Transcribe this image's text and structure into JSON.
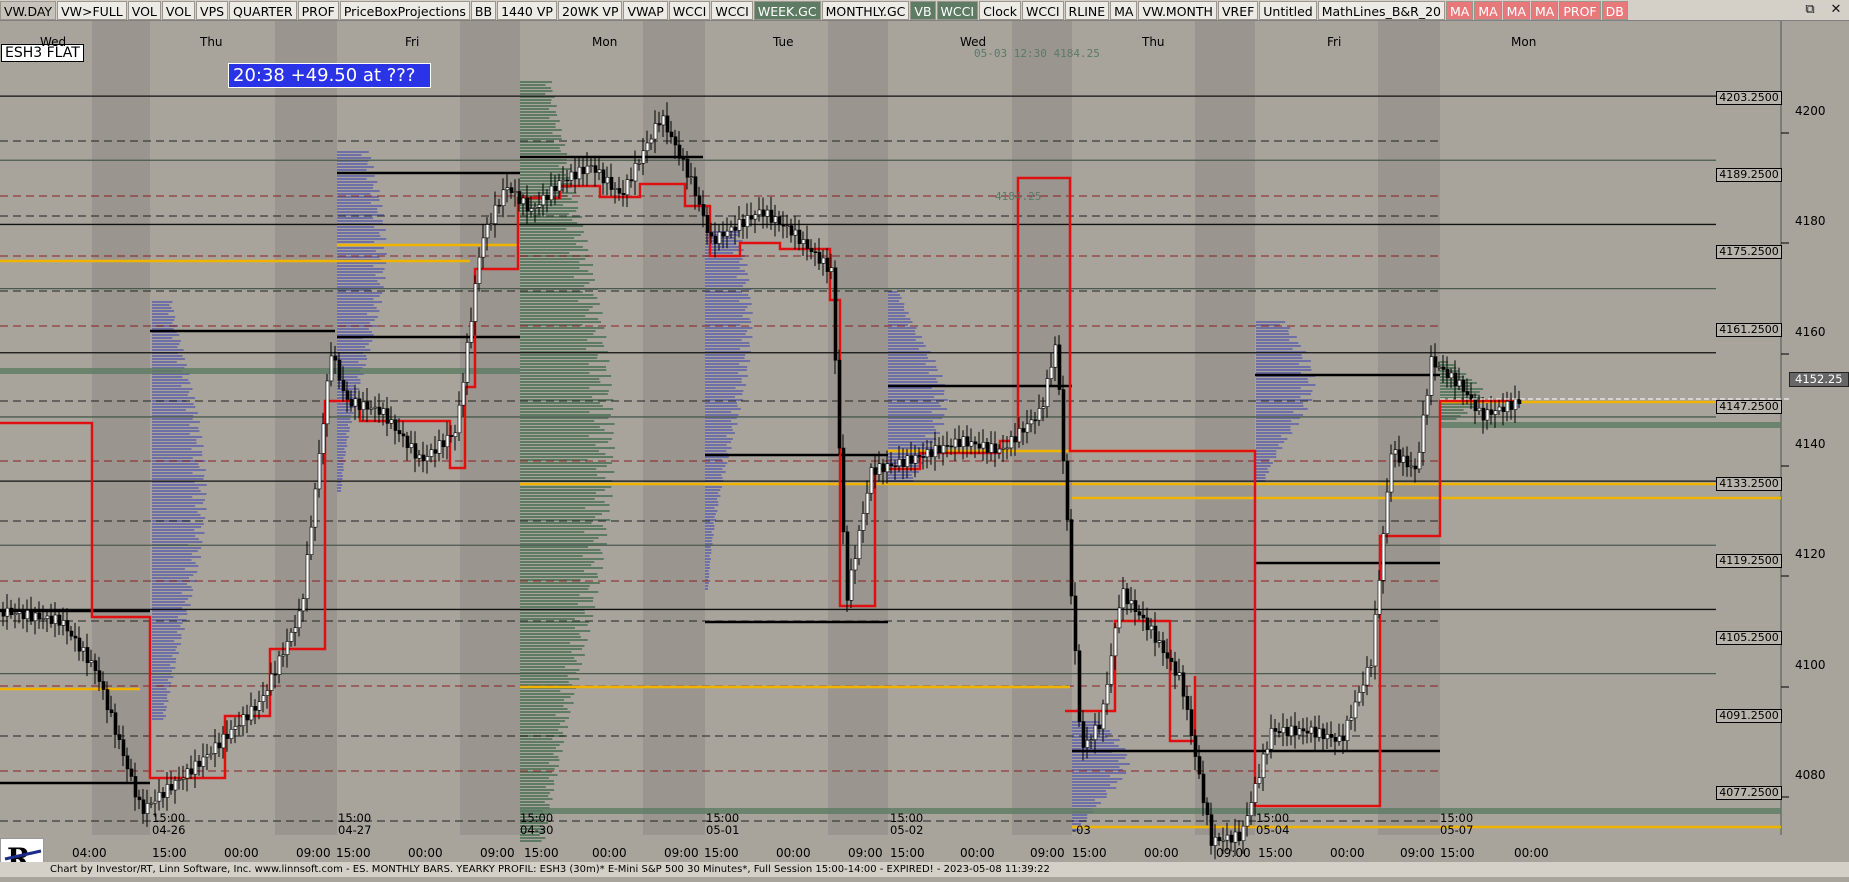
{
  "toolbar": {
    "buttons": [
      {
        "label": "VW.DAY",
        "style": "sel"
      },
      {
        "label": "VW>FULL",
        "style": ""
      },
      {
        "label": "VOL",
        "style": ""
      },
      {
        "label": "VOL",
        "style": ""
      },
      {
        "label": "VPS",
        "style": ""
      },
      {
        "label": "QUARTER",
        "style": ""
      },
      {
        "label": "PROF",
        "style": ""
      },
      {
        "label": "PriceBoxProjections",
        "style": ""
      },
      {
        "label": "BB",
        "style": ""
      },
      {
        "label": "1440 VP",
        "style": ""
      },
      {
        "label": "20WK VP",
        "style": ""
      },
      {
        "label": "VWAP",
        "style": ""
      },
      {
        "label": "WCCI",
        "style": ""
      },
      {
        "label": "WCCI",
        "style": ""
      },
      {
        "label": "WEEK.GC",
        "style": "green"
      },
      {
        "label": "MONTHLY.GC",
        "style": ""
      },
      {
        "label": "VB",
        "style": "green"
      },
      {
        "label": "WCCI",
        "style": "green"
      },
      {
        "label": "Clock",
        "style": ""
      },
      {
        "label": "WCCI",
        "style": ""
      },
      {
        "label": "RLINE",
        "style": ""
      },
      {
        "label": "MA",
        "style": ""
      },
      {
        "label": "VW.MONTH",
        "style": ""
      },
      {
        "label": "VREF",
        "style": ""
      },
      {
        "label": "Untitled",
        "style": ""
      },
      {
        "label": "MathLines_B&R_20",
        "style": ""
      },
      {
        "label": "MA",
        "style": "red"
      },
      {
        "label": "MA",
        "style": "red"
      },
      {
        "label": "MA",
        "style": "red"
      },
      {
        "label": "MA",
        "style": "red"
      },
      {
        "label": "PROF",
        "style": "red"
      },
      {
        "label": "DB",
        "style": "red"
      }
    ],
    "window_controls": [
      "⧉",
      "✕"
    ]
  },
  "chart": {
    "symbol_label": "ESH3 FLAT",
    "info_box": "20:38  +49.50 at ???",
    "cursor_readout": "05-03  12:30  4184.25",
    "marker_label": "4184.25",
    "current_price": "4152.25",
    "price_boxes": [
      "4203.2500",
      "4189.2500",
      "4175.2500",
      "4161.2500",
      "4147.2500",
      "4133.2500",
      "4119.2500",
      "4105.2500",
      "4091.2500",
      "4077.2500"
    ],
    "axis_ticks": [
      "4200",
      "4180",
      "4160",
      "4140",
      "4120",
      "4100",
      "4080"
    ],
    "day_labels": [
      "Wed",
      "Thu",
      "Fri",
      "Mon",
      "Tue",
      "Wed",
      "Thu",
      "Fri",
      "Mon"
    ],
    "time_labels": [
      "04:00",
      "15:00",
      "00:00",
      "09:00",
      "15:00",
      "00:00",
      "09:00",
      "15:00",
      "00:00",
      "09:00",
      "15:00",
      "00:00",
      "09:00",
      "15:00",
      "00:00",
      "09:00",
      "15:00",
      "00:00",
      "09:00",
      "15:00",
      "00:00",
      "09:00",
      "15:00",
      "00:00"
    ],
    "session_labels": [
      {
        "time": "15:00",
        "date": "04-26"
      },
      {
        "time": "15:00",
        "date": "04-27"
      },
      {
        "time": "15:00",
        "date": "04-30"
      },
      {
        "time": "15:00",
        "date": "05-01"
      },
      {
        "time": "15:00",
        "date": "05-02"
      },
      {
        "time": "",
        "date": "-03"
      },
      {
        "time": "15:00",
        "date": "05-04"
      },
      {
        "time": "15:00",
        "date": "05-07"
      }
    ]
  },
  "footer": "Chart by Investor/RT, Linn Software, Inc. www.linnsoft.com - ES. MONTHLY BARS. YEARKY PROFIL: ESH3 (30m)* E-Mini S&P 500 30 Minutes*, Full Session 15:00-14:00 - EXPIRED! - 2023-05-08 11:39:22",
  "colors": {
    "background": "#a8a49c",
    "session_band": "#9d9992",
    "profile_blue": "#6d6fa6",
    "profile_green": "#5d7a63",
    "vwap_red": "#e01010",
    "level_yellow": "#f0b400"
  },
  "icons": [
    "restore-icon",
    "close-icon",
    "investor-rt-logo"
  ]
}
